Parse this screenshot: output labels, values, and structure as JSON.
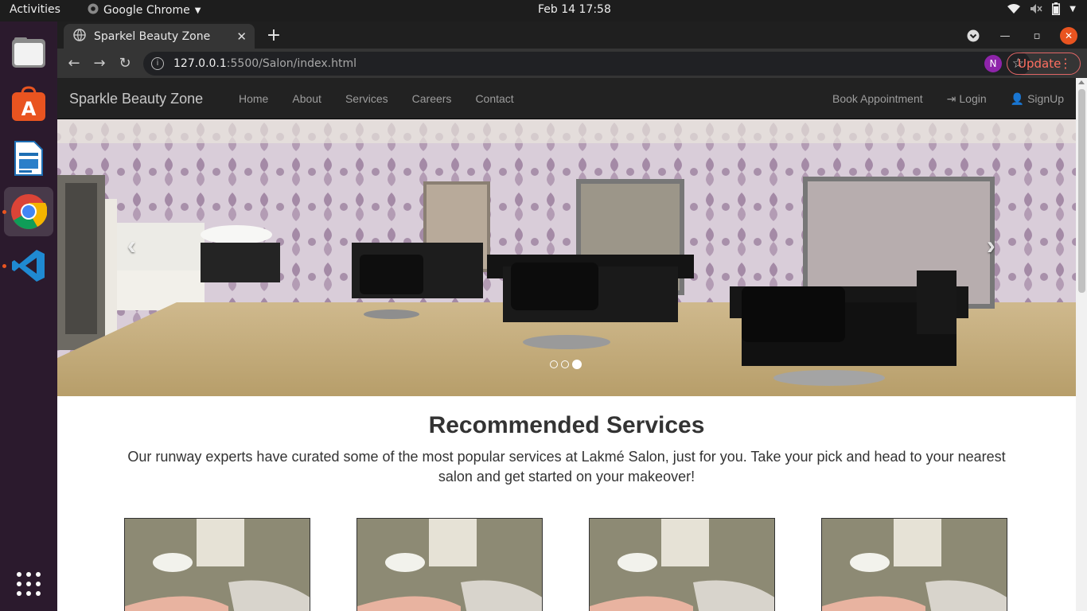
{
  "system": {
    "activities": "Activities",
    "app_name": "Google Chrome",
    "clock": "Feb 14  17:58"
  },
  "browser": {
    "tab_title": "Sparkel Beauty Zone",
    "url_host": "127.0.0.1",
    "url_path": ":5500/Salon/index.html",
    "profile_initial": "N",
    "update_label": "Update"
  },
  "site": {
    "brand": "Sparkle Beauty Zone",
    "nav": [
      "Home",
      "About",
      "Services",
      "Careers",
      "Contact"
    ],
    "book_label": "Book Appointment",
    "login_label": "Login",
    "signup_label": "SignUp",
    "carousel": {
      "slide_count": 3,
      "active_index": 2
    },
    "section_title": "Recommended Services",
    "section_text": "Our runway experts have curated some of the most popular services at Lakmé Salon, just for you. Take your pick and head to your nearest salon and get started on your makeover!",
    "service_cards": 4
  },
  "colors": {
    "navbar_bg": "#222222",
    "nav_text": "#9d9d9d",
    "accent": "#e95420"
  }
}
